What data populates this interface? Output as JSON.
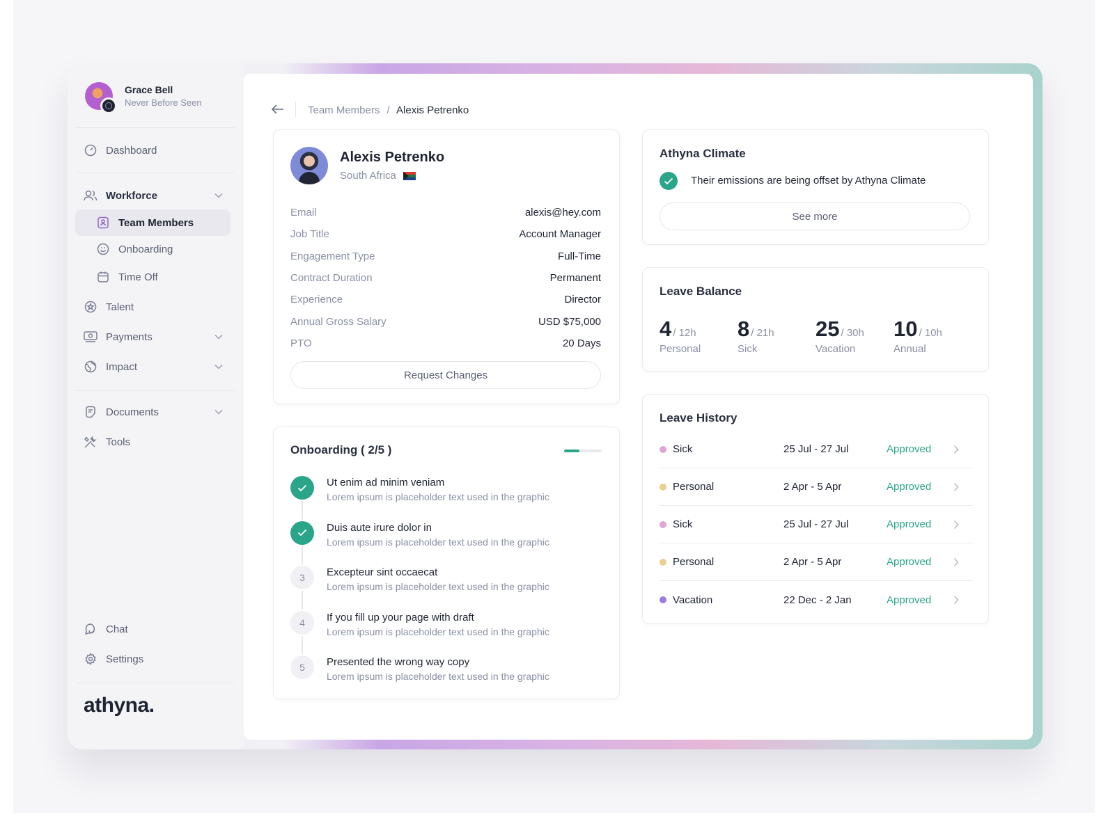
{
  "user": {
    "name": "Grace Bell",
    "subtitle": "Never Before Seen"
  },
  "nav": {
    "dashboard": "Dashboard",
    "workforce": "Workforce",
    "team_members": "Team Members",
    "onboarding": "Onboarding",
    "time_off": "Time Off",
    "talent": "Talent",
    "payments": "Payments",
    "impact": "Impact",
    "documents": "Documents",
    "tools": "Tools",
    "chat": "Chat",
    "settings": "Settings"
  },
  "logo": "athyna.",
  "breadcrumb": {
    "parent": "Team Members",
    "separator": "/",
    "current": "Alexis Petrenko"
  },
  "profile": {
    "name": "Alexis Petrenko",
    "country": "South Africa",
    "details": [
      {
        "label": "Email",
        "value": "alexis@hey.com"
      },
      {
        "label": "Job Title",
        "value": "Account Manager"
      },
      {
        "label": "Engagement Type",
        "value": "Full-Time"
      },
      {
        "label": "Contract Duration",
        "value": "Permanent"
      },
      {
        "label": "Experience",
        "value": "Director"
      },
      {
        "label": "Annual Gross Salary",
        "value": "USD $75,000"
      },
      {
        "label": "PTO",
        "value": "20 Days"
      }
    ],
    "request_button": "Request Changes"
  },
  "onboarding": {
    "title": "Onboarding ( 2/5 )",
    "progress": 0.4,
    "steps": [
      {
        "marker": "",
        "title": "Ut enim ad minim veniam",
        "sub": "Lorem ipsum is placeholder text used in the graphic",
        "done": true
      },
      {
        "marker": "",
        "title": "Duis aute irure dolor in",
        "sub": "Lorem ipsum is placeholder text used in the graphic",
        "done": true
      },
      {
        "marker": "3",
        "title": "Excepteur sint occaecat",
        "sub": "Lorem ipsum is placeholder text used in the graphic",
        "done": false
      },
      {
        "marker": "4",
        "title": "If you fill up your page with draft",
        "sub": "Lorem ipsum is placeholder text used in the graphic",
        "done": false
      },
      {
        "marker": "5",
        "title": "Presented the wrong way copy",
        "sub": "Lorem ipsum is placeholder text used in the graphic",
        "done": false
      }
    ]
  },
  "climate": {
    "title": "Athyna Climate",
    "message": "Their emissions are being offset by Athyna Climate",
    "button": "See more"
  },
  "leave_balance": {
    "title": "Leave Balance",
    "items": [
      {
        "value": "4",
        "total": "/ 12h",
        "label": "Personal"
      },
      {
        "value": "8",
        "total": "/ 21h",
        "label": "Sick"
      },
      {
        "value": "25",
        "total": "/ 30h",
        "label": "Vacation"
      },
      {
        "value": "10",
        "total": "/ 10h",
        "label": "Annual"
      }
    ]
  },
  "leave_history": {
    "title": "Leave History",
    "rows": [
      {
        "type": "Sick",
        "dates": "25 Jul - 27 Jul",
        "status": "Approved",
        "color": "#e2a3d7"
      },
      {
        "type": "Personal",
        "dates": "2 Apr - 5 Apr",
        "status": "Approved",
        "color": "#ead08f"
      },
      {
        "type": "Sick",
        "dates": "25 Jul - 27 Jul",
        "status": "Approved",
        "color": "#e2a3d7"
      },
      {
        "type": "Personal",
        "dates": "2 Apr - 5 Apr",
        "status": "Approved",
        "color": "#ead08f"
      },
      {
        "type": "Vacation",
        "dates": "22 Dec - 2 Jan",
        "status": "Approved",
        "color": "#9a7be0"
      }
    ]
  },
  "colors": {
    "accent": "#2aa58a",
    "brand_purple": "#8a67c9",
    "text_dark": "#1f2433",
    "text_muted": "#8a8fa6"
  }
}
